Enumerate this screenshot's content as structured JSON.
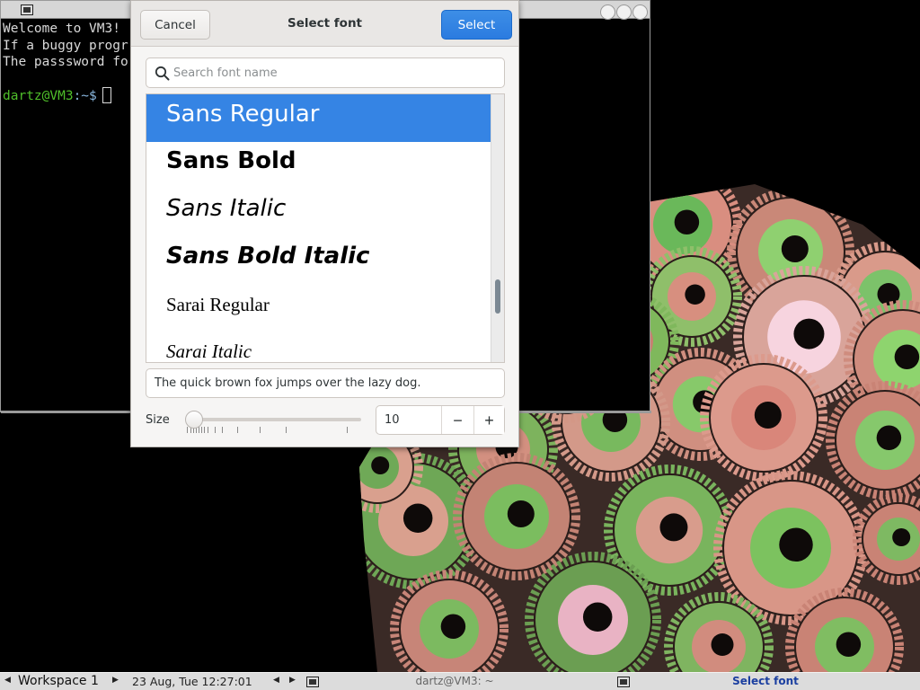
{
  "terminal": {
    "lines": [
      "Welcome to VM3!",
      "If a buggy progr",
      "The passsword fo"
    ],
    "prompt_user": "dartz@VM3",
    "prompt_path": ":~$"
  },
  "dialog": {
    "title": "Select font",
    "cancel_label": "Cancel",
    "select_label": "Select",
    "search": {
      "placeholder": "Search font name",
      "value": ""
    },
    "fonts": [
      {
        "label": "Sans Regular",
        "selected": true
      },
      {
        "label": "Sans Bold",
        "selected": false
      },
      {
        "label": "Sans Italic",
        "selected": false
      },
      {
        "label": "Sans Bold Italic",
        "selected": false
      },
      {
        "label": "Sarai Regular",
        "selected": false
      },
      {
        "label": "Sarai Italic",
        "selected": false
      }
    ],
    "preview_text": "The quick brown fox jumps over the lazy dog.",
    "size_label": "Size",
    "size_value": "10",
    "accent_color": "#3584e4"
  },
  "taskbar": {
    "workspace": "Workspace 1",
    "clock": "23 Aug, Tue 12:27:01",
    "tasks": [
      {
        "label": "dartz@VM3: ~",
        "icon": "terminal-icon",
        "active": false
      },
      {
        "label": "Select font",
        "icon": "terminal-icon",
        "active": true
      }
    ]
  }
}
